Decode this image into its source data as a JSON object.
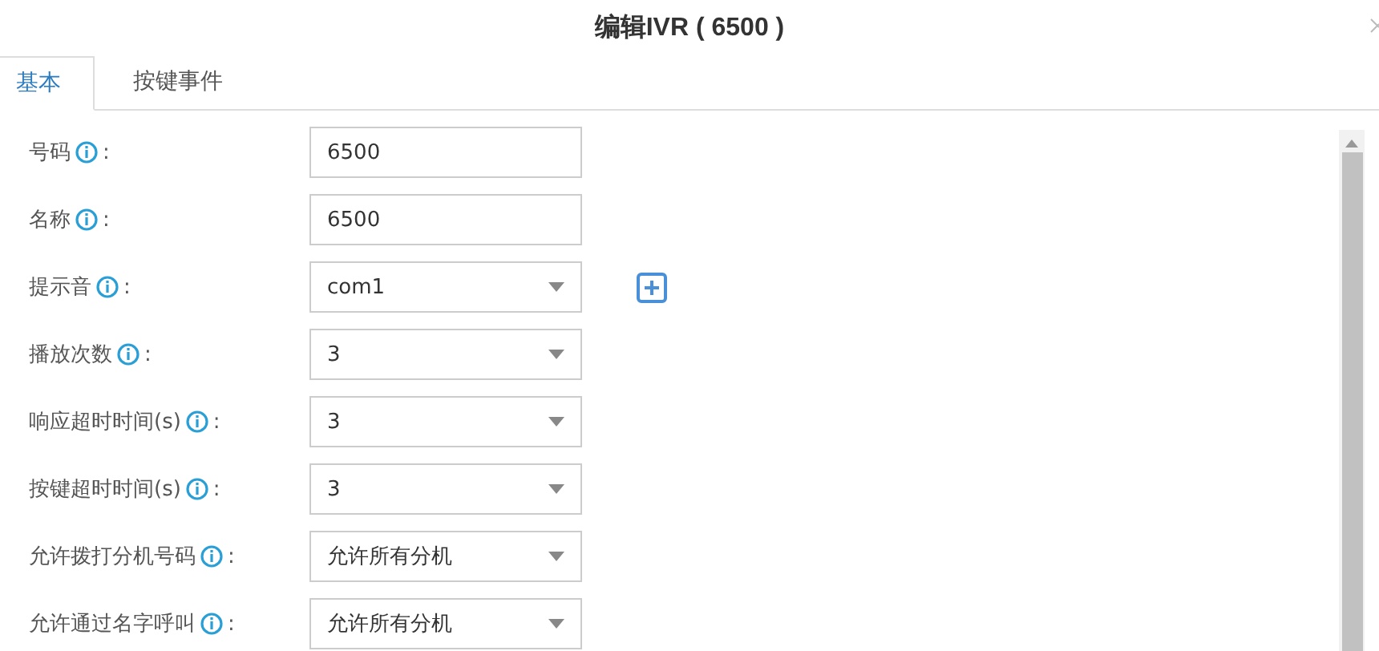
{
  "dialog": {
    "title": "编辑IVR ( 6500 )"
  },
  "tabs": [
    {
      "label": "基本",
      "selected": true
    },
    {
      "label": "按键事件",
      "selected": false
    }
  ],
  "fields": [
    {
      "label": "号码",
      "kind": "text",
      "value": "6500",
      "add_button": false,
      "suffix": ":"
    },
    {
      "label": "名称",
      "kind": "text",
      "value": "6500",
      "add_button": false,
      "suffix": ":"
    },
    {
      "label": "提示音",
      "kind": "select",
      "value": "com1",
      "add_button": true,
      "suffix": ":"
    },
    {
      "label": "播放次数",
      "kind": "select",
      "value": "3",
      "add_button": false,
      "suffix": ":"
    },
    {
      "label": "响应超时时间(s)",
      "kind": "select",
      "value": "3",
      "add_button": false,
      "suffix": ":"
    },
    {
      "label": "按键超时时间(s)",
      "kind": "select",
      "value": "3",
      "add_button": false,
      "suffix": ":"
    },
    {
      "label": "允许拨打分机号码",
      "kind": "select",
      "value": "允许所有分机",
      "add_button": false,
      "suffix": ":"
    },
    {
      "label": "允许通过名字呼叫",
      "kind": "select",
      "value": "允许所有分机",
      "add_button": false,
      "suffix": ":"
    }
  ]
}
